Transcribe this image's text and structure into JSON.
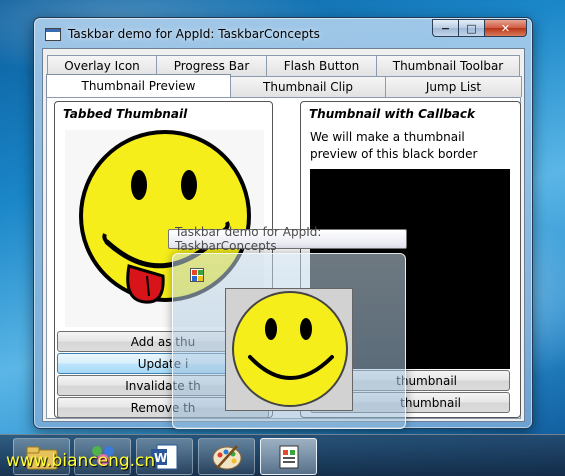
{
  "window": {
    "title": "Taskbar demo for AppId: TaskbarConcepts",
    "minimize_glyph": "−",
    "maximize_glyph": "□",
    "close_glyph": "✕"
  },
  "tabs": {
    "back_row": [
      "Overlay Icon",
      "Progress Bar",
      "Flash Button",
      "Thumbnail Toolbar"
    ],
    "front_row": [
      "Thumbnail Preview",
      "Thumbnail Clip",
      "Jump List"
    ],
    "selected": "Thumbnail Preview"
  },
  "left_group": {
    "title": "Tabbed Thumbnail",
    "buttons": [
      "Add as thu",
      "Update i",
      "Invalidate th",
      "Remove th"
    ]
  },
  "right_group": {
    "title": "Thumbnail with Callback",
    "text": "We will make a thumbnail preview of this black border",
    "buttons": [
      "thumbnail",
      "thumbnail"
    ]
  },
  "tooltip": "Taskbar demo for AppId: TaskbarConcepts",
  "watermark": "www.bianceng.cn",
  "colors": {
    "smiley_yellow": "#f5ee1a",
    "tongue_red": "#d7141a",
    "black_box": "#000000"
  },
  "taskbar": {
    "items": [
      "start-orb",
      "messenger-icon",
      "word-icon",
      "paint-icon",
      "taskbar-demo-app-icon"
    ],
    "active": "taskbar-demo-app-icon"
  }
}
